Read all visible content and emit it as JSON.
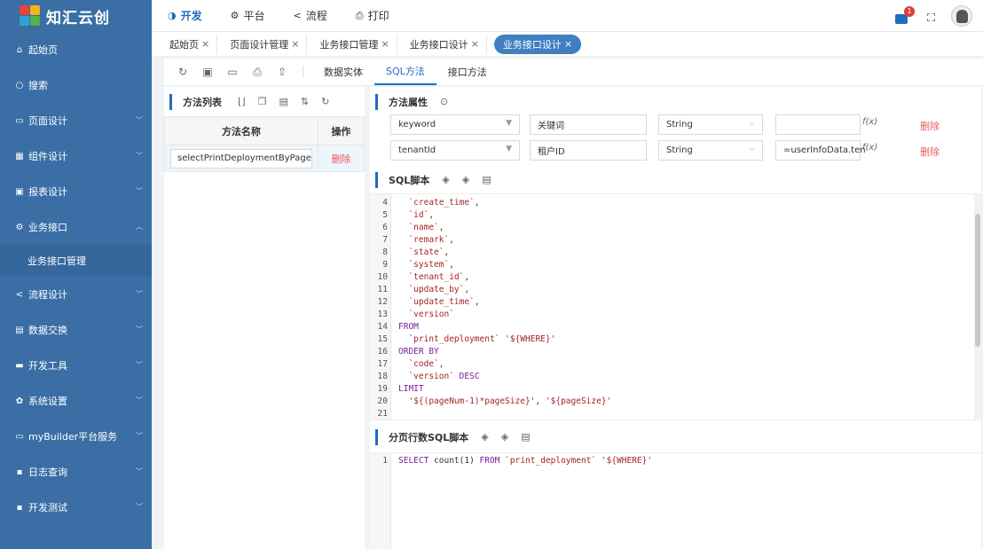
{
  "app": {
    "title": "知汇云创"
  },
  "sidebar": {
    "items": [
      {
        "label": "起始页",
        "icon": "home-icon",
        "glyph": "⌂"
      },
      {
        "label": "搜索",
        "icon": "search-icon",
        "glyph": "○"
      },
      {
        "label": "页面设计",
        "icon": "window-icon",
        "glyph": "▭"
      },
      {
        "label": "组件设计",
        "icon": "grid-icon",
        "glyph": "▦"
      },
      {
        "label": "报表设计",
        "icon": "report-icon",
        "glyph": "▣"
      },
      {
        "label": "业务接口",
        "icon": "gear-icon",
        "glyph": "⚙"
      },
      {
        "label": "流程设计",
        "icon": "share-icon",
        "glyph": "<"
      },
      {
        "label": "数据交换",
        "icon": "database-icon",
        "glyph": "▤"
      },
      {
        "label": "开发工具",
        "icon": "toolbox-icon",
        "glyph": "▬"
      },
      {
        "label": "系统设置",
        "icon": "settings-icon",
        "glyph": "✿"
      },
      {
        "label": "myBuilder平台服务",
        "icon": "monitor-icon",
        "glyph": "▭"
      },
      {
        "label": "日志查询",
        "icon": "log-icon",
        "glyph": "▪"
      },
      {
        "label": "开发测试",
        "icon": "test-icon",
        "glyph": "▪"
      }
    ],
    "subitem": "业务接口管理"
  },
  "topnav": {
    "items": [
      {
        "label": "开发",
        "icon": "dev-icon",
        "glyph": "◑"
      },
      {
        "label": "平台",
        "icon": "gear-icon",
        "glyph": "⚙"
      },
      {
        "label": "流程",
        "icon": "share-icon",
        "glyph": "<"
      },
      {
        "label": "打印",
        "icon": "printer-icon",
        "glyph": "⎙"
      }
    ],
    "badge_count": "1"
  },
  "page_tabs": [
    "起始页",
    "页面设计管理",
    "业务接口管理",
    "业务接口设计",
    "业务接口设计"
  ],
  "toolbar": {
    "close_glyph": "×"
  },
  "sub_tabs": [
    "数据实体",
    "SQL方法",
    "接口方法"
  ],
  "method_list": {
    "title": "方法列表",
    "col_name": "方法名称",
    "col_action": "操作",
    "rows": [
      {
        "name": "selectPrintDeploymentByPage",
        "action": "删除"
      }
    ]
  },
  "method_props": {
    "title": "方法属性",
    "rows": [
      {
        "param": "keyword",
        "label": "关键词",
        "type": "String",
        "expr": "",
        "fx": "f(x)",
        "action": "删除"
      },
      {
        "param": "tenantId",
        "label": "租户ID",
        "type": "String",
        "expr": "=userInfoData.ten",
        "fx": "f(x)",
        "action": "删除"
      }
    ]
  },
  "sql_script": {
    "title": "SQL脚本",
    "lines": [
      {
        "n": "4",
        "t": "  `create_time`,"
      },
      {
        "n": "5",
        "t": "  `id`,"
      },
      {
        "n": "6",
        "t": "  `name`,"
      },
      {
        "n": "7",
        "t": "  `remark`,"
      },
      {
        "n": "8",
        "t": "  `state`,"
      },
      {
        "n": "9",
        "t": "  `system`,"
      },
      {
        "n": "10",
        "t": "  `tenant_id`,"
      },
      {
        "n": "11",
        "t": "  `update_by`,"
      },
      {
        "n": "12",
        "t": "  `update_time`,"
      },
      {
        "n": "13",
        "t": "  `version`"
      },
      {
        "n": "14",
        "t": "FROM"
      },
      {
        "n": "15",
        "t": "  `print_deployment` '${WHERE}'"
      },
      {
        "n": "16",
        "t": "ORDER BY"
      },
      {
        "n": "17",
        "t": "  `code`,"
      },
      {
        "n": "18",
        "t": "  `version` DESC"
      },
      {
        "n": "19",
        "t": "LIMIT"
      },
      {
        "n": "20",
        "t": "  '${(pageNum-1)*pageSize}', '${pageSize}'"
      },
      {
        "n": "21",
        "t": ""
      }
    ]
  },
  "count_script": {
    "title": "分页行数SQL脚本",
    "lines": [
      {
        "n": "1",
        "t": "SELECT count(1) FROM `print_deployment` '${WHERE}'"
      }
    ]
  },
  "colors": {
    "sidebar": "#3a6ea5",
    "accent": "#1f6cc1",
    "danger": "#e85c5c"
  }
}
